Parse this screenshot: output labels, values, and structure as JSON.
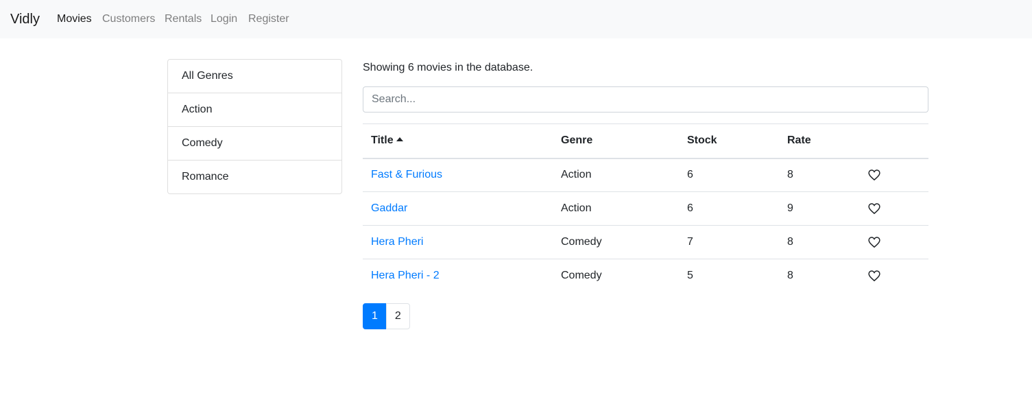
{
  "navbar": {
    "brand": "Vidly",
    "links": [
      {
        "label": "Movies",
        "active": true
      },
      {
        "label": "Customers",
        "active": false
      },
      {
        "label": "Rentals",
        "active": false
      },
      {
        "label": "Login",
        "active": false
      },
      {
        "label": "Register",
        "active": false
      }
    ]
  },
  "genres": [
    "All Genres",
    "Action",
    "Comedy",
    "Romance"
  ],
  "summary": "Showing 6 movies in the database.",
  "search": {
    "placeholder": "Search...",
    "value": ""
  },
  "table": {
    "headers": {
      "title": "Title",
      "genre": "Genre",
      "stock": "Stock",
      "rate": "Rate"
    },
    "sort": {
      "column": "title",
      "order": "asc",
      "icon": "caret-up-icon"
    },
    "rows": [
      {
        "title": "Fast & Furious",
        "genre": "Action",
        "stock": "6",
        "rate": "8",
        "liked": false
      },
      {
        "title": "Gaddar",
        "genre": "Action",
        "stock": "6",
        "rate": "9",
        "liked": false
      },
      {
        "title": "Hera Pheri",
        "genre": "Comedy",
        "stock": "7",
        "rate": "8",
        "liked": false
      },
      {
        "title": "Hera Pheri - 2",
        "genre": "Comedy",
        "stock": "5",
        "rate": "8",
        "liked": false
      }
    ],
    "like_icon": "heart-outline-icon"
  },
  "pagination": {
    "pages": [
      "1",
      "2"
    ],
    "current": "1"
  },
  "colors": {
    "primary": "#007bff",
    "navbar_bg": "#f8f9fa",
    "border": "#dee2e6"
  }
}
